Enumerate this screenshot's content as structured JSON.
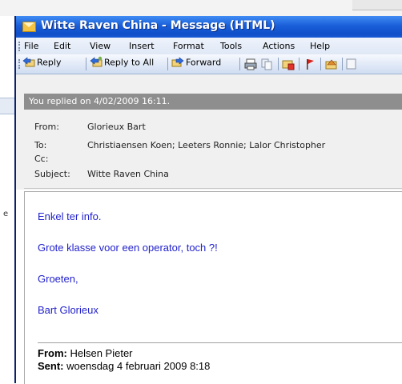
{
  "window": {
    "title": "Witte Raven China - Message (HTML)"
  },
  "menu": [
    "File",
    "Edit",
    "View",
    "Insert",
    "Format",
    "Tools",
    "Actions",
    "Help"
  ],
  "toolbar": {
    "reply": "Reply",
    "reply_all": "Reply to All",
    "forward": "Forward"
  },
  "info_bar": "You replied on 4/02/2009 16:11.",
  "header": {
    "from_label": "From:",
    "from": "Glorieux Bart",
    "to_label": "To:",
    "to": "Christiaensen Koen; Leeters Ronnie; Lalor Christopher",
    "cc_label": "Cc:",
    "cc": "",
    "subject_label": "Subject:",
    "subject": "Witte Raven China"
  },
  "body": {
    "lines": [
      "Enkel ter info.",
      "Grote klasse voor een operator, toch ?!",
      "Groeten,",
      "Bart Glorieux"
    ],
    "quoted": {
      "from_label": "From:",
      "from": "Helsen Pieter",
      "sent_label": "Sent:",
      "sent": "woensdag 4 februari 2009 8:18"
    }
  },
  "colors": {
    "title_bar": "#1a5ed9",
    "body_text": "#2222cc",
    "info_bar": "#8e8e8e"
  },
  "icons": [
    "envelope-icon",
    "reply-icon",
    "reply-all-icon",
    "forward-icon",
    "print-icon",
    "copy-icon",
    "move-to-folder-icon",
    "flag-icon",
    "previous-item-icon"
  ]
}
